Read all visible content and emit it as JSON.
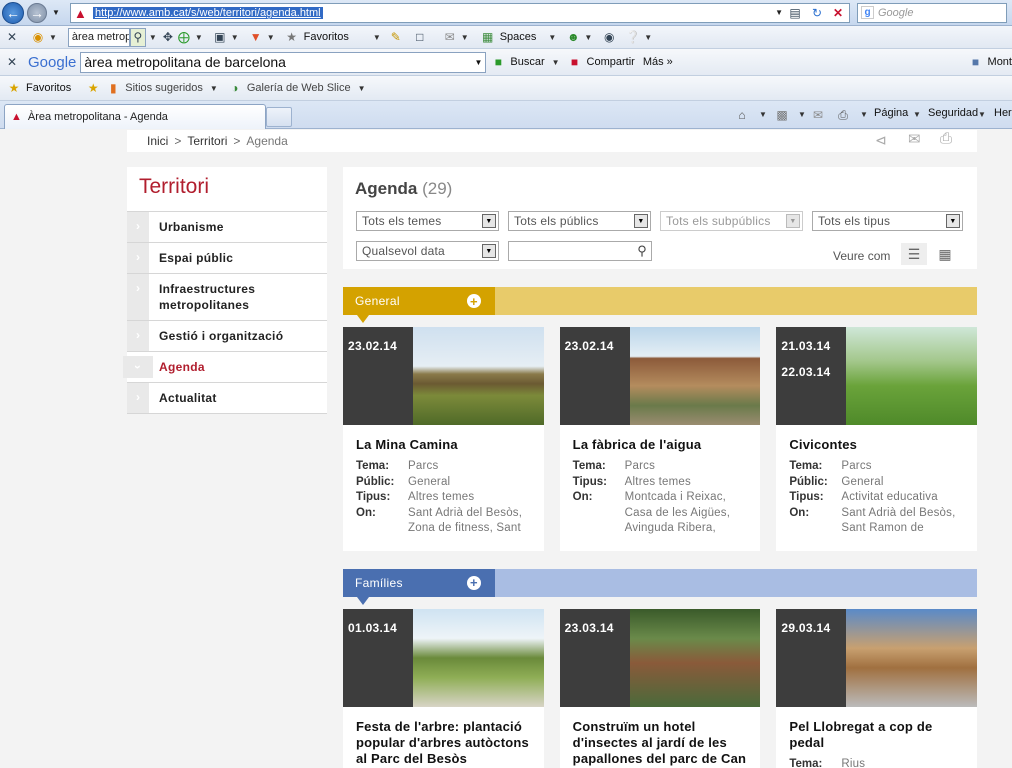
{
  "browser": {
    "url": "http://www.amb.cat/s/web/territori/agenda.html",
    "search_placeholder": "Google",
    "toolbar_search_value": "àrea metropo",
    "favorites_menu": "Favoritos",
    "spaces": "Spaces",
    "google_brand": "Google",
    "google_query": "àrea metropolitana de barcelona",
    "buscar": "Buscar",
    "compartir": "Compartir",
    "mas": "Más »",
    "user_label": "Mont",
    "favorites_bar": {
      "favoritos": "Favoritos",
      "sitios": "Sitios sugeridos",
      "galeria": "Galería de Web Slice"
    },
    "tab_title": "Àrea metropolitana - Agenda",
    "pagina": "Página",
    "seguridad": "Seguridad",
    "herramientas": "Her"
  },
  "breadcrumb": {
    "inici": "Inici",
    "territori": "Territori",
    "agenda": "Agenda",
    "sep": ">"
  },
  "sidebar": {
    "title": "Territori",
    "items": [
      {
        "label": "Urbanisme"
      },
      {
        "label": "Espai públic"
      },
      {
        "label": "Infraestructures metropolitanes"
      },
      {
        "label": "Gestió i organització"
      },
      {
        "label": "Agenda"
      },
      {
        "label": "Actualitat"
      }
    ]
  },
  "agenda": {
    "title": "Agenda",
    "count": "(29)",
    "filters": {
      "temes": "Tots els temes",
      "publics": "Tots els públics",
      "subpublics": "Tots els subpúblics",
      "tipus": "Tots els tipus",
      "data": "Qualsevol data"
    },
    "veure_com": "Veure com"
  },
  "labels": {
    "tema": "Tema:",
    "public": "Públic:",
    "tipus": "Tipus:",
    "on": "On:"
  },
  "categories": [
    {
      "name": "General",
      "color": "#d4a200",
      "bar_color": "#e8cb6a",
      "cards": [
        {
          "dates": [
            "23.02.14"
          ],
          "title": "La Mina Camina",
          "tema": "Parcs",
          "public": "General",
          "tipus": "Altres temes",
          "on": "Sant Adrià del Besòs, Zona de fitness, Sant"
        },
        {
          "dates": [
            "23.02.14"
          ],
          "title": "La fàbrica de l'aigua",
          "tema": "Parcs",
          "tipus": "Altres temes",
          "on": "Montcada i Reixac, Casa de les Aigües, Avinguda Ribera,"
        },
        {
          "dates": [
            "21.03.14",
            "22.03.14"
          ],
          "title": "Civicontes",
          "tema": "Parcs",
          "public": "General",
          "tipus": "Activitat educativa",
          "on": "Sant Adrià del Besòs, Sant Ramon de"
        }
      ]
    },
    {
      "name": "Famílies",
      "color": "#4a6fb0",
      "bar_color": "#a9bde3",
      "cards": [
        {
          "dates": [
            "01.03.14"
          ],
          "title": "Festa de l'arbre: plantació popular d'arbres autòctons al Parc del Besòs"
        },
        {
          "dates": [
            "23.03.14"
          ],
          "title": "Construïm un hotel d'insectes al jardí de les papallones del parc de Can"
        },
        {
          "dates": [
            "29.03.14"
          ],
          "title": "Pel Llobregat a cop de pedal",
          "tema": "Rius"
        }
      ]
    }
  ]
}
